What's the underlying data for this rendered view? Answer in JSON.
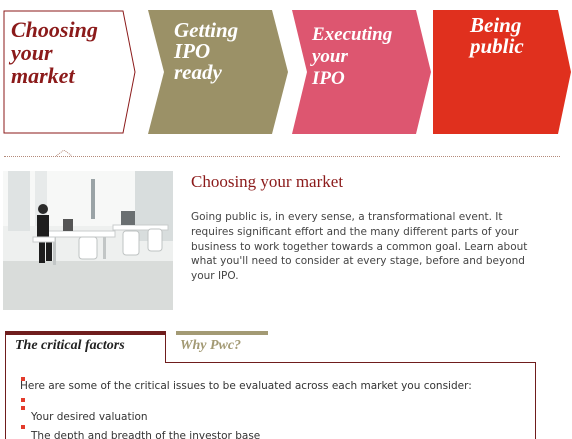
{
  "steps": [
    {
      "label": "Choosing\nyour\nmarket",
      "active": true
    },
    {
      "label": "Getting\nIPO\nready",
      "active": false
    },
    {
      "label": "Executing\nyour\nIPO",
      "active": false
    },
    {
      "label": "Being\npublic",
      "active": false
    }
  ],
  "colors": {
    "step_active_border": "#8b1a1a",
    "step_2": "#9b9167",
    "step_3": "#dd5670",
    "step_4": "#e0301e",
    "accent_red": "#e33b2b",
    "tab_active": "#6f1d1d",
    "tab_inactive": "#a39a74"
  },
  "intro": {
    "title": "Choosing your market",
    "body": "Going public is, in every sense, a transformational event. It requires significant effort and the many different parts of your business to work together towards a common goal. Learn about what you'll need to consider at every stage, before and beyond your IPO."
  },
  "tabs": [
    {
      "label": "The critical factors",
      "active": true
    },
    {
      "label": "Why Pwc?",
      "active": false
    }
  ],
  "panel": {
    "lead": "Here are some of the critical issues to be evaluated across each market you consider:",
    "items": [
      "Your desired valuation",
      "The depth and breadth of the investor base"
    ]
  }
}
